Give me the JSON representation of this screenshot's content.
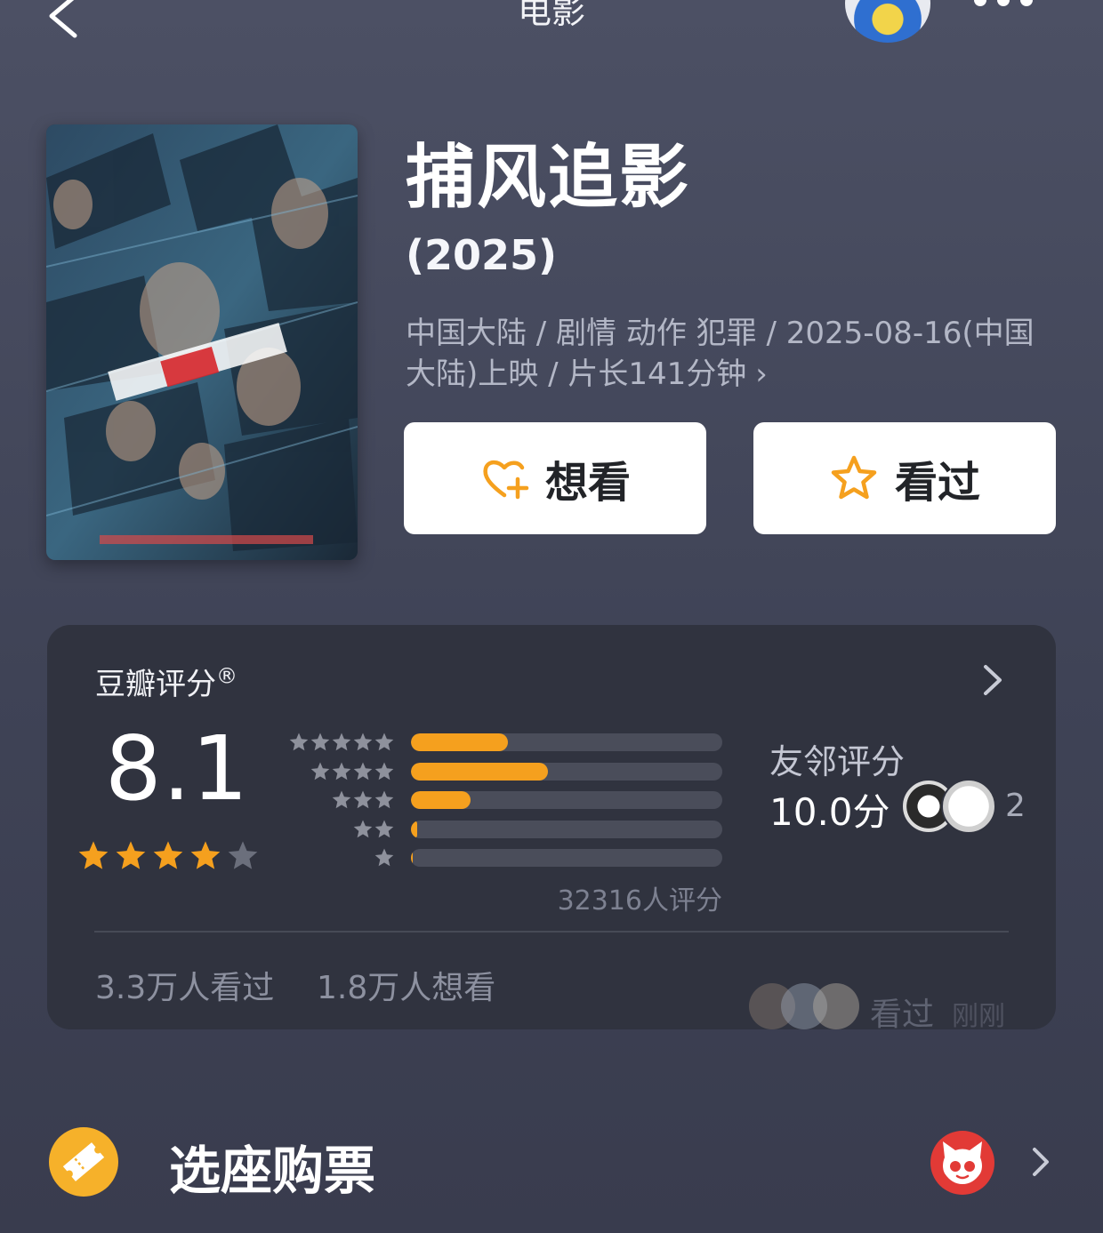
{
  "nav": {
    "title": "电影",
    "back_icon": "back-chevron-icon",
    "more_icon": "more-dots-icon",
    "avatar_icon": "user-avatar"
  },
  "movie": {
    "title": "捕风追影",
    "year": "(2025)",
    "meta": "中国大陆 / 剧情 动作 犯罪 / 2025-08-16(中国大陆)上映 / 片长141分钟",
    "meta_chevron": "›"
  },
  "actions": {
    "want_label": "想看",
    "want_icon": "heart-plus-icon",
    "seen_label": "看过",
    "seen_icon": "star-outline-icon"
  },
  "rating": {
    "title": "豆瓣评分",
    "title_mark": "®",
    "score": "8.1",
    "stars_filled": 4,
    "stars_total": 5,
    "distribution": [
      {
        "stars": 5,
        "fraction": 0.31
      },
      {
        "stars": 4,
        "fraction": 0.44
      },
      {
        "stars": 3,
        "fraction": 0.19
      },
      {
        "stars": 2,
        "fraction": 0.02
      },
      {
        "stars": 1,
        "fraction": 0.005
      }
    ],
    "count": "32316人评分",
    "friends_label": "友邻评分",
    "friends_score": "10.0分",
    "friends_count": "2",
    "seen_stat": "3.3万人看过",
    "want_stat": "1.8万人想看",
    "activity_text": "看过",
    "activity_time": "刚刚"
  },
  "ticket": {
    "label": "选座购票",
    "icon": "ticket-icon",
    "partner_icon": "cat-eye-icon"
  },
  "colors": {
    "accent": "#f5a01e",
    "card_bg": "#30333f",
    "page_bg": "#444858"
  }
}
